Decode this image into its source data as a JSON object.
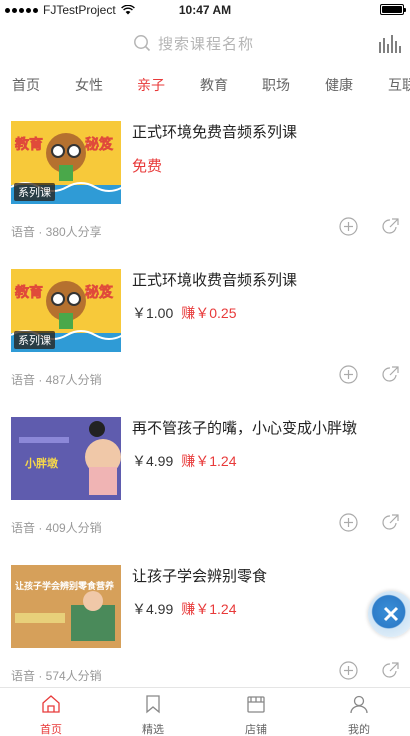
{
  "status_bar": {
    "carrier": "FJTestProject",
    "time": "10:47 AM"
  },
  "search": {
    "placeholder": "搜索课程名称"
  },
  "tabs": [
    {
      "label": "首页",
      "active": false
    },
    {
      "label": "女性",
      "active": false
    },
    {
      "label": "亲子",
      "active": true
    },
    {
      "label": "教育",
      "active": false
    },
    {
      "label": "职场",
      "active": false
    },
    {
      "label": "健康",
      "active": false
    },
    {
      "label": "互联",
      "active": false
    }
  ],
  "courses": [
    {
      "title": "正式环境免费音频系列课",
      "free_label": "免费",
      "badge": "系列课",
      "thumb_text": "教育秘笈",
      "meta": "语音 · 380人分享"
    },
    {
      "title": "正式环境收费音频系列课",
      "price": "￥1.00",
      "earn": "赚￥0.25",
      "badge": "系列课",
      "thumb_text": "教育秘笈",
      "meta": "语音 · 487人分销"
    },
    {
      "title": "再不管孩子的嘴，小心变成小胖墩",
      "price": "￥4.99",
      "earn": "赚￥1.24",
      "thumb_text": "小胖墩",
      "meta": "语音 · 409人分销"
    },
    {
      "title": "让孩子学会辨别零食",
      "price": "￥4.99",
      "earn": "赚￥1.24",
      "thumb_text": "让孩子学会辨别零食营养",
      "meta": "语音 · 574人分销"
    }
  ],
  "tabbar": [
    {
      "label": "首页",
      "icon": "home-icon",
      "active": true
    },
    {
      "label": "精选",
      "icon": "bookmark-icon",
      "active": false
    },
    {
      "label": "店铺",
      "icon": "store-icon",
      "active": false
    },
    {
      "label": "我的",
      "icon": "user-icon",
      "active": false
    }
  ],
  "colors": {
    "accent": "#e83a3a",
    "muted": "#999999"
  }
}
